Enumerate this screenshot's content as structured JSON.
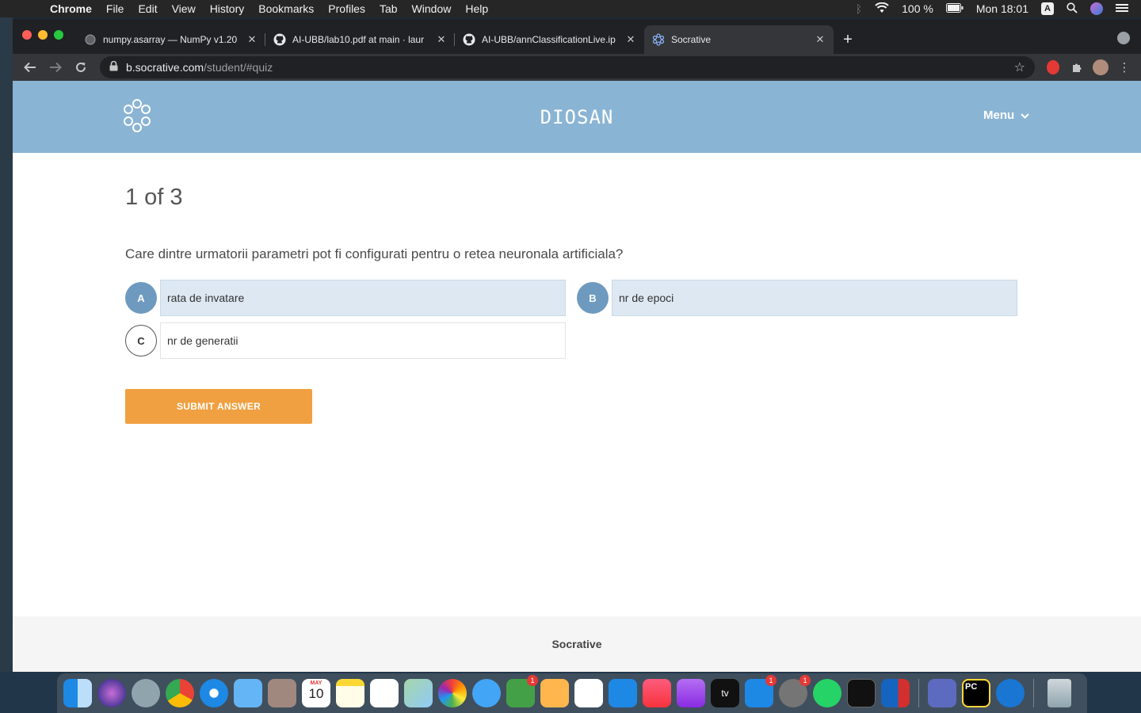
{
  "menubar": {
    "app_name": "Chrome",
    "items": [
      "File",
      "Edit",
      "View",
      "History",
      "Bookmarks",
      "Profiles",
      "Tab",
      "Window",
      "Help"
    ],
    "battery": "100 %",
    "clock": "Mon 18:01",
    "input_source": "A"
  },
  "browser": {
    "tabs": [
      {
        "label": "numpy.asarray — NumPy v1.20",
        "icon": "globe-icon",
        "active": false
      },
      {
        "label": "AI-UBB/lab10.pdf at main · laur",
        "icon": "github-icon",
        "active": false
      },
      {
        "label": "AI-UBB/annClassificationLive.ip",
        "icon": "github-icon",
        "active": false
      },
      {
        "label": "Socrative",
        "icon": "socrative-icon",
        "active": true
      }
    ],
    "new_tab": "+",
    "url_host": "b.socrative.com",
    "url_path": "/student/#quiz"
  },
  "site": {
    "room_name": "DIOSAN",
    "menu_label": "Menu",
    "header_color": "#8ab4d4"
  },
  "quiz": {
    "counter": "1 of 3",
    "question": "Care dintre urmatorii parametri pot fi configurati pentru o retea neuronala artificiala?",
    "answers": [
      {
        "letter": "A",
        "text": "rata de invatare",
        "selected": true
      },
      {
        "letter": "B",
        "text": "nr de epoci",
        "selected": true
      },
      {
        "letter": "C",
        "text": "nr de generatii",
        "selected": false
      }
    ],
    "submit_label": "SUBMIT ANSWER",
    "submit_color": "#f0a040"
  },
  "footer": {
    "brand": "Socrative"
  },
  "dock": {
    "calendar_month": "MAY",
    "calendar_day": "10",
    "appletv_label": "tv",
    "pycharm_label": "PC",
    "badges": {
      "facetime": "1",
      "appstore": "1",
      "settings": "1"
    }
  }
}
